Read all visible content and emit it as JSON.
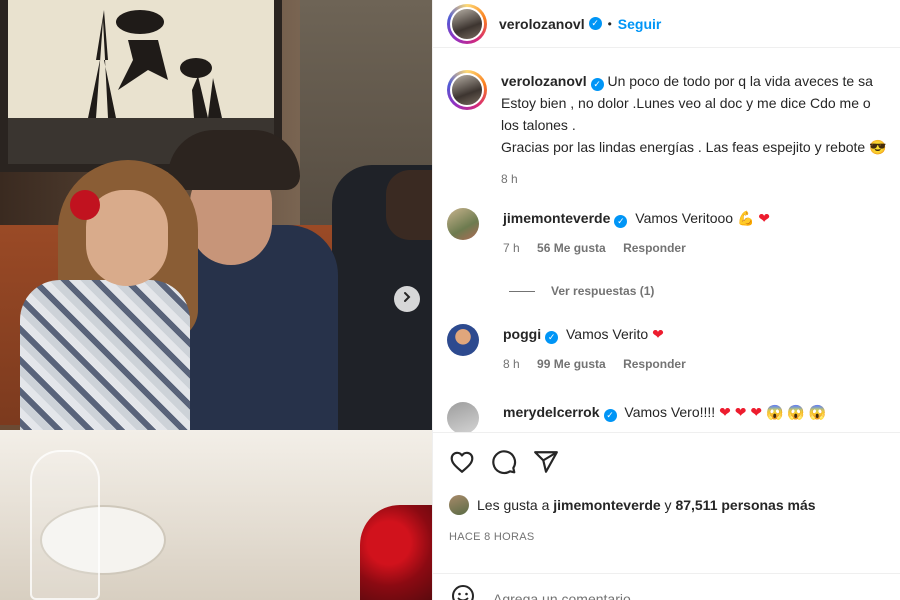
{
  "header": {
    "username": "verolozanovl",
    "follow_label": "Seguir",
    "separator": "•"
  },
  "caption": {
    "username": "verolozanovl",
    "lines": [
      "Un poco de todo por q la vida aveces te sa",
      "Estoy bien , no dolor .Lunes veo al doc y me dice Cdo me o",
      "los talones .",
      "Gracias por las lindas energías . Las feas espejito y rebote"
    ],
    "time": "8 h"
  },
  "comments": [
    {
      "username": "jimemonteverde",
      "text": "Vamos Veritooo",
      "emojis": [
        "💪",
        "❤"
      ],
      "time": "7 h",
      "likes": "56 Me gusta",
      "reply_label": "Responder",
      "view_replies": "Ver respuestas (1)"
    },
    {
      "username": "poggi",
      "text": "Vamos Verito",
      "emojis": [
        "❤"
      ],
      "time": "8 h",
      "likes": "99 Me gusta",
      "reply_label": "Responder"
    },
    {
      "username": "merydelcerrok",
      "text": "Vamos Vero!!!!",
      "emojis": [
        "❤",
        "❤",
        "❤",
        "😱",
        "😱",
        "😱"
      ]
    }
  ],
  "likes_summary": {
    "prefix": "Les gusta a",
    "user": "jimemonteverde",
    "connector": "y",
    "count": "87,511 personas más"
  },
  "time_ago": "HACE 8 HORAS",
  "comment_input": {
    "placeholder": "Agrega un comentario..."
  },
  "icons": {
    "like": "heart-icon",
    "comment": "comment-icon",
    "share": "share-icon",
    "emoji": "emoji-icon",
    "next": "chevron-right-icon"
  },
  "colors": {
    "accent": "#0095f6",
    "heart": "#ed1c2e",
    "muted": "#737373"
  }
}
